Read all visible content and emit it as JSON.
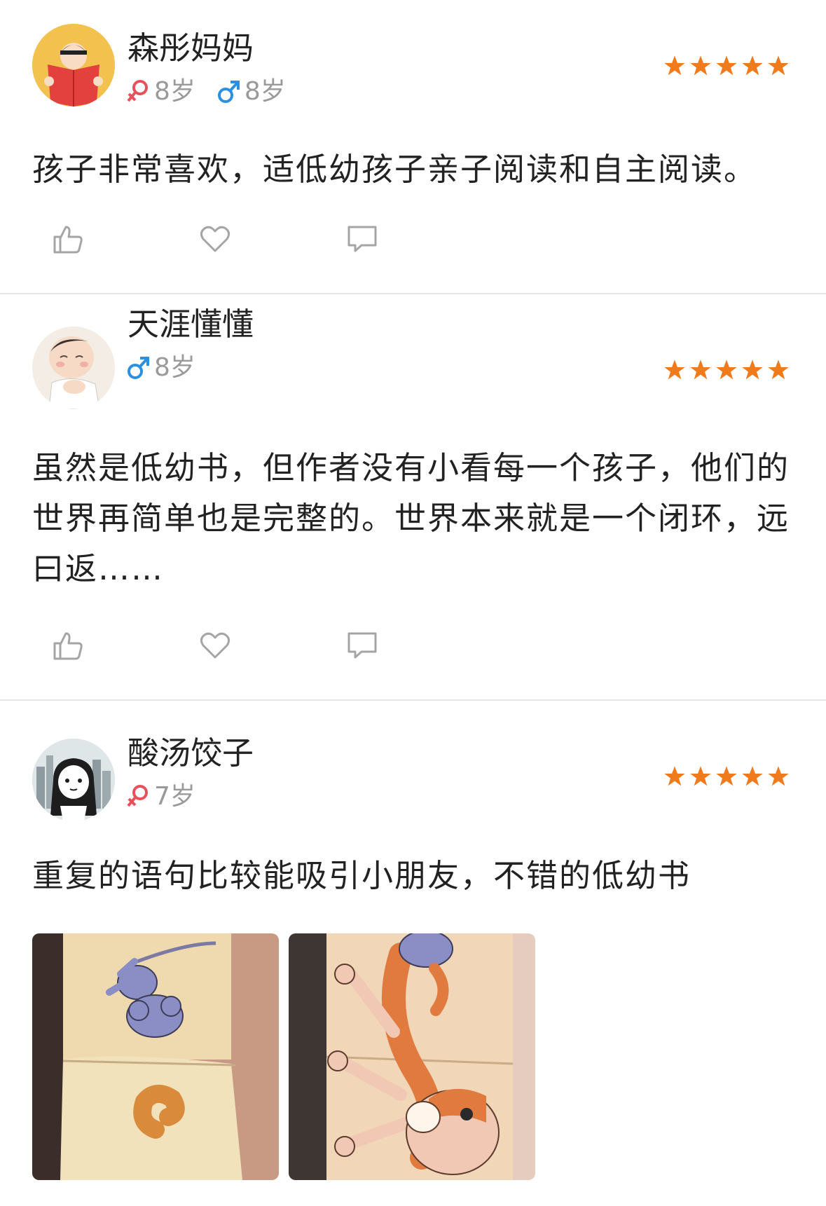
{
  "reviews": [
    {
      "username": "森彤妈妈",
      "children": [
        {
          "gender": "female",
          "age": "8岁"
        },
        {
          "gender": "male",
          "age": "8岁"
        }
      ],
      "rating": 5,
      "content": "孩子非常喜欢，适低幼孩子亲子阅读和自主阅读。"
    },
    {
      "username": "天涯懂懂",
      "children": [
        {
          "gender": "male",
          "age": "8岁"
        }
      ],
      "rating": 5,
      "content": "虽然是低幼书，但作者没有小看每一个孩子，他们的世界再简单也是完整的。世界本来就是一个闭环，远曰返……"
    },
    {
      "username": "酸汤饺子",
      "children": [
        {
          "gender": "female",
          "age": "7岁"
        }
      ],
      "rating": 5,
      "content": "重复的语句比较能吸引小朋友，不错的低幼书"
    }
  ],
  "colors": {
    "star": "#f07b1d",
    "female": "#e8505b",
    "male": "#2d8fe0",
    "icon_gray": "#a5a5a5"
  },
  "icons": [
    "thumbs-up-icon",
    "heart-icon",
    "comment-icon",
    "star-icon",
    "female-icon",
    "male-icon"
  ]
}
